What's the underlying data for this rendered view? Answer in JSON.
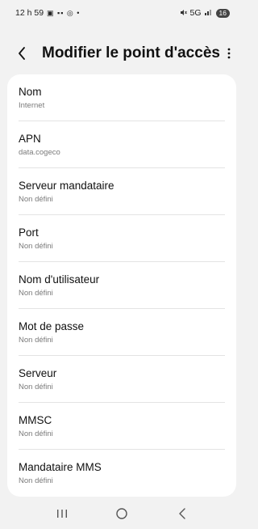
{
  "status_bar": {
    "time": "12 h 59",
    "notification_icons": "▣ ▪▪ ◎ •",
    "network": "5G",
    "battery": "16"
  },
  "header": {
    "title": "Modifier le point d'accès"
  },
  "settings": [
    {
      "label": "Nom",
      "value": "Internet"
    },
    {
      "label": "APN",
      "value": "data.cogeco"
    },
    {
      "label": "Serveur mandataire",
      "value": "Non défini"
    },
    {
      "label": "Port",
      "value": "Non défini"
    },
    {
      "label": "Nom d'utilisateur",
      "value": "Non défini"
    },
    {
      "label": "Mot de passe",
      "value": "Non défini"
    },
    {
      "label": "Serveur",
      "value": "Non défini"
    },
    {
      "label": "MMSC",
      "value": "Non défini"
    },
    {
      "label": "Mandataire MMS",
      "value": "Non défini"
    }
  ],
  "icons": {
    "back": "chevron-left-icon",
    "more": "more-vertical-icon",
    "nav_recents": "recents-icon",
    "nav_home": "home-icon",
    "nav_back": "back-icon"
  }
}
